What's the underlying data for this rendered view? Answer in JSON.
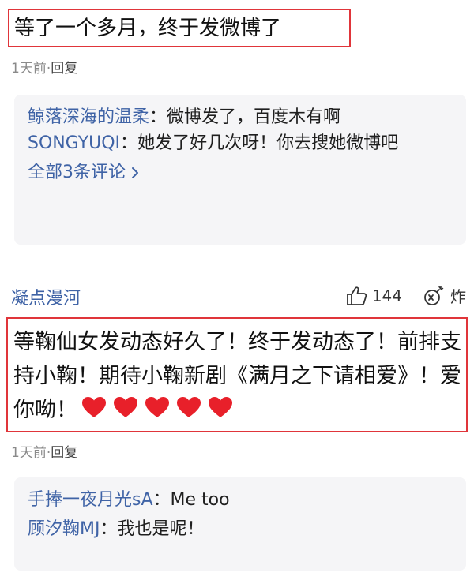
{
  "comment1": {
    "text": "等了一个多月，终于发微博了",
    "time": "1天前",
    "separator": "·",
    "reply_label": "回复",
    "replies": [
      {
        "user": "鲸落深海的温柔",
        "colon": "：",
        "text": "微博发了，百度木有啊"
      },
      {
        "user": "SONGYUQI",
        "colon": "：",
        "text": "她发了好几次呀！你去搜她微博吧"
      }
    ],
    "see_all": "全部3条评论"
  },
  "comment2": {
    "user": "凝点漫河",
    "likes": "144",
    "action_label": "炸",
    "text": "等鞠仙女发动态好久了！终于发动态了！前排支持小鞠！期待小鞠新剧《满月之下请相爱》！爱你呦！",
    "heart_count": 5,
    "heart_color": "#e8202a",
    "time": "1天前",
    "separator": "·",
    "reply_label": "回复",
    "replies": [
      {
        "user": "手捧一夜月光sA",
        "colon": "：",
        "text": "Me too"
      },
      {
        "user": "顾汐鞠MJ",
        "colon": "：",
        "text": "我也是呢！"
      }
    ]
  },
  "colors": {
    "highlight_border": "#e0353a",
    "username_blue": "#3f63a6",
    "reply_bg": "#f5f5f7"
  }
}
